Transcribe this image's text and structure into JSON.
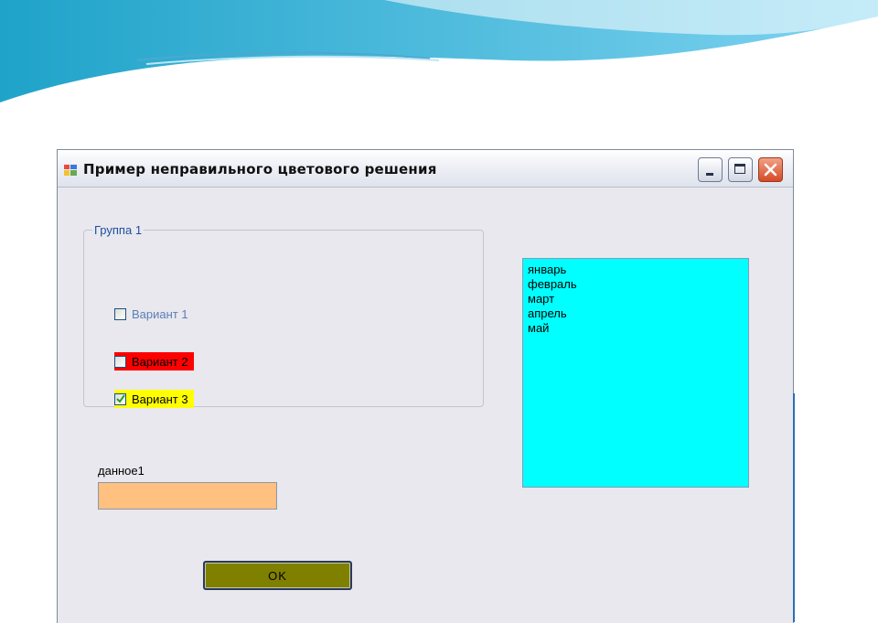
{
  "window": {
    "title": "Пример неправильного цветового решения",
    "icon": "app-window-icon",
    "controls": [
      "minimize-icon",
      "maximize-icon",
      "close-icon"
    ]
  },
  "group": {
    "title": "Группа 1",
    "options": [
      {
        "label": "Вариант 1",
        "checked": false,
        "background": "#e8e8ee",
        "text_color": "#5b7fb5"
      },
      {
        "label": "Вариант 2",
        "checked": false,
        "background": "#ff0000",
        "text_color": "#000000"
      },
      {
        "label": "Вариант 3",
        "checked": true,
        "background": "#ffff00",
        "text_color": "#000000"
      }
    ]
  },
  "field": {
    "label": "данное1",
    "value": "",
    "background": "#ffc080"
  },
  "ok_button": {
    "label": "OK",
    "background": "#808000"
  },
  "listbox": {
    "background": "#00ffff",
    "items": [
      "январь",
      "февраль",
      "март",
      "апрель",
      "май"
    ]
  }
}
